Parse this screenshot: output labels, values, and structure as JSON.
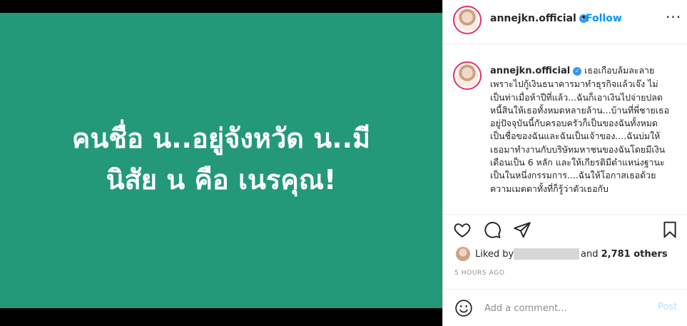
{
  "media": {
    "bg_color": "#239979",
    "text_lines": [
      "คนชื่อ น..อยู่จังหวัด น..มี",
      "นิสัย น คือ เนรคุณ!"
    ]
  },
  "header": {
    "username": "annejkn.official",
    "verified_icon": "verified-badge-icon",
    "separator": "•",
    "follow_label": "Follow",
    "more_icon": "more-options-icon"
  },
  "caption": {
    "username": "annejkn.official",
    "text": "เธอเกือบล้มละลาย เพราะไปกู้เงินธนาคารมาทำธุรกิจแล้วเจ๊ง ไม่เป็นท่าเมื่อห้าปีที่แล้ว...ฉันก็เอาเงินไปจ่ายปลดหนี้สินให้เธอทั้งหมดหลายล้าน...บ้านที่พี่ชายเธออยู่ปัจจุบันนี้กับครอบครัวก็เป็นของฉันทั้งหมด เป็นชื่อของฉันและฉันเป็นเจ้าของ....ฉันบ่มให้เธอมาทำงานกับบริษัทมหาชนของฉันโดยมีเงินเดือนเป็น 6 หลัก และให้เกียรติมีตำแหน่งฐานะเป็นในหนึ่งกรรมการ....ฉันให้โอกาสเธอด้วยความเมตตาทั้งที่ก็รู้ว่าตัวเธอกับ"
  },
  "actions": {
    "icons": [
      "heart-icon",
      "comment-icon",
      "share-icon",
      "bookmark-icon"
    ]
  },
  "likes": {
    "prefix": "Liked by",
    "joiner": "and",
    "others": "2,781 others"
  },
  "timestamp": "5 HOURS AGO",
  "comment_box": {
    "emoji_icon": "emoji-icon",
    "placeholder": "Add a comment...",
    "post_label": "Post"
  },
  "colors": {
    "link": "#0095f6",
    "verified": "#3897f0",
    "muted": "#8e8e8e",
    "post_disabled": "#b2dffc"
  }
}
